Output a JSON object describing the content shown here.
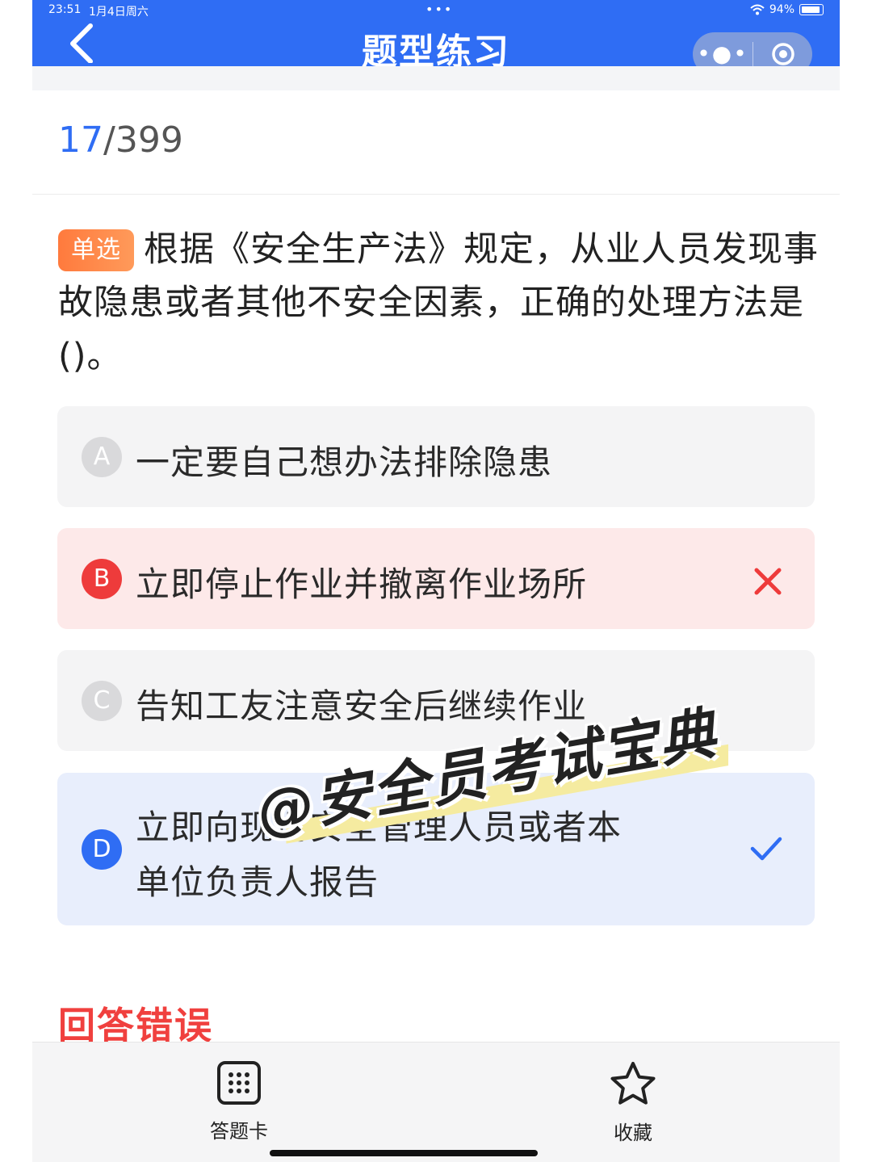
{
  "status_bar": {
    "time": "23:51",
    "date": "1月4日周六",
    "dots": "•••",
    "battery": "94%"
  },
  "header": {
    "title": "题型练习",
    "more_icon": "more-dots-icon",
    "target_icon": "target-icon"
  },
  "progress": {
    "current": "17",
    "total": "/399"
  },
  "question": {
    "type_tag": "单选",
    "text": "根据《安全生产法》规定，从业人员发现事故隐患或者其他不安全因素，正确的处理方法是()。"
  },
  "options": [
    {
      "letter": "A",
      "text": "一定要自己想办法排除隐患",
      "state": "normal"
    },
    {
      "letter": "B",
      "text": "立即停止作业并撤离作业场所",
      "state": "wrong"
    },
    {
      "letter": "C",
      "text": "告知工友注意安全后继续作业",
      "state": "normal"
    },
    {
      "letter": "D",
      "text_line1": "立即向现场安全管理人员或者本",
      "text_line2": "单位负责人报告",
      "state": "correct"
    }
  ],
  "result": {
    "text": "回答错误"
  },
  "watermark": {
    "text": "@安全员考试宝典"
  },
  "tabbar": {
    "answer_card": {
      "label": "答题卡",
      "icon": "grid-icon"
    },
    "favorite": {
      "label": "收藏",
      "icon": "star-icon"
    }
  },
  "colors": {
    "primary": "#2f6df4",
    "wrong": "#f0403e",
    "tag": "#ff7a3d"
  }
}
